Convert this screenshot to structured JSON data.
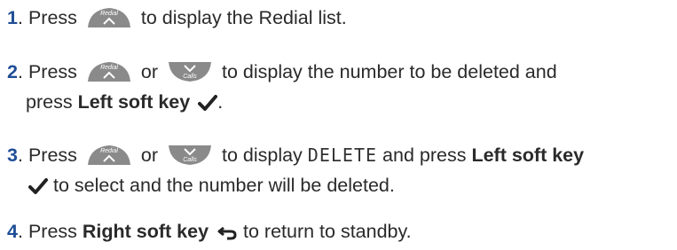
{
  "keys": {
    "redial_key_label": "Redial",
    "calls_key_label": "Calls",
    "key_color": "#8a8a8a"
  },
  "steps": [
    {
      "number": "1",
      "dot": ".",
      "press": "Press",
      "text_after": "to display the Redial list."
    },
    {
      "number": "2",
      "dot": ".",
      "press": "Press",
      "or": "or",
      "text_after": "to display the number to be deleted and",
      "line2_press": "press",
      "soft_key": "Left soft key",
      "end": "."
    },
    {
      "number": "3",
      "dot": ".",
      "press": "Press",
      "or": "or",
      "text_after": "to display",
      "display_word": "DELETE",
      "and_press": "and press",
      "soft_key": "Left soft key",
      "line2_text": "to select and the number will be deleted."
    },
    {
      "number": "4",
      "dot": ".",
      "press": "Press",
      "soft_key": "Right soft key",
      "text_after": "to return to standby."
    }
  ]
}
